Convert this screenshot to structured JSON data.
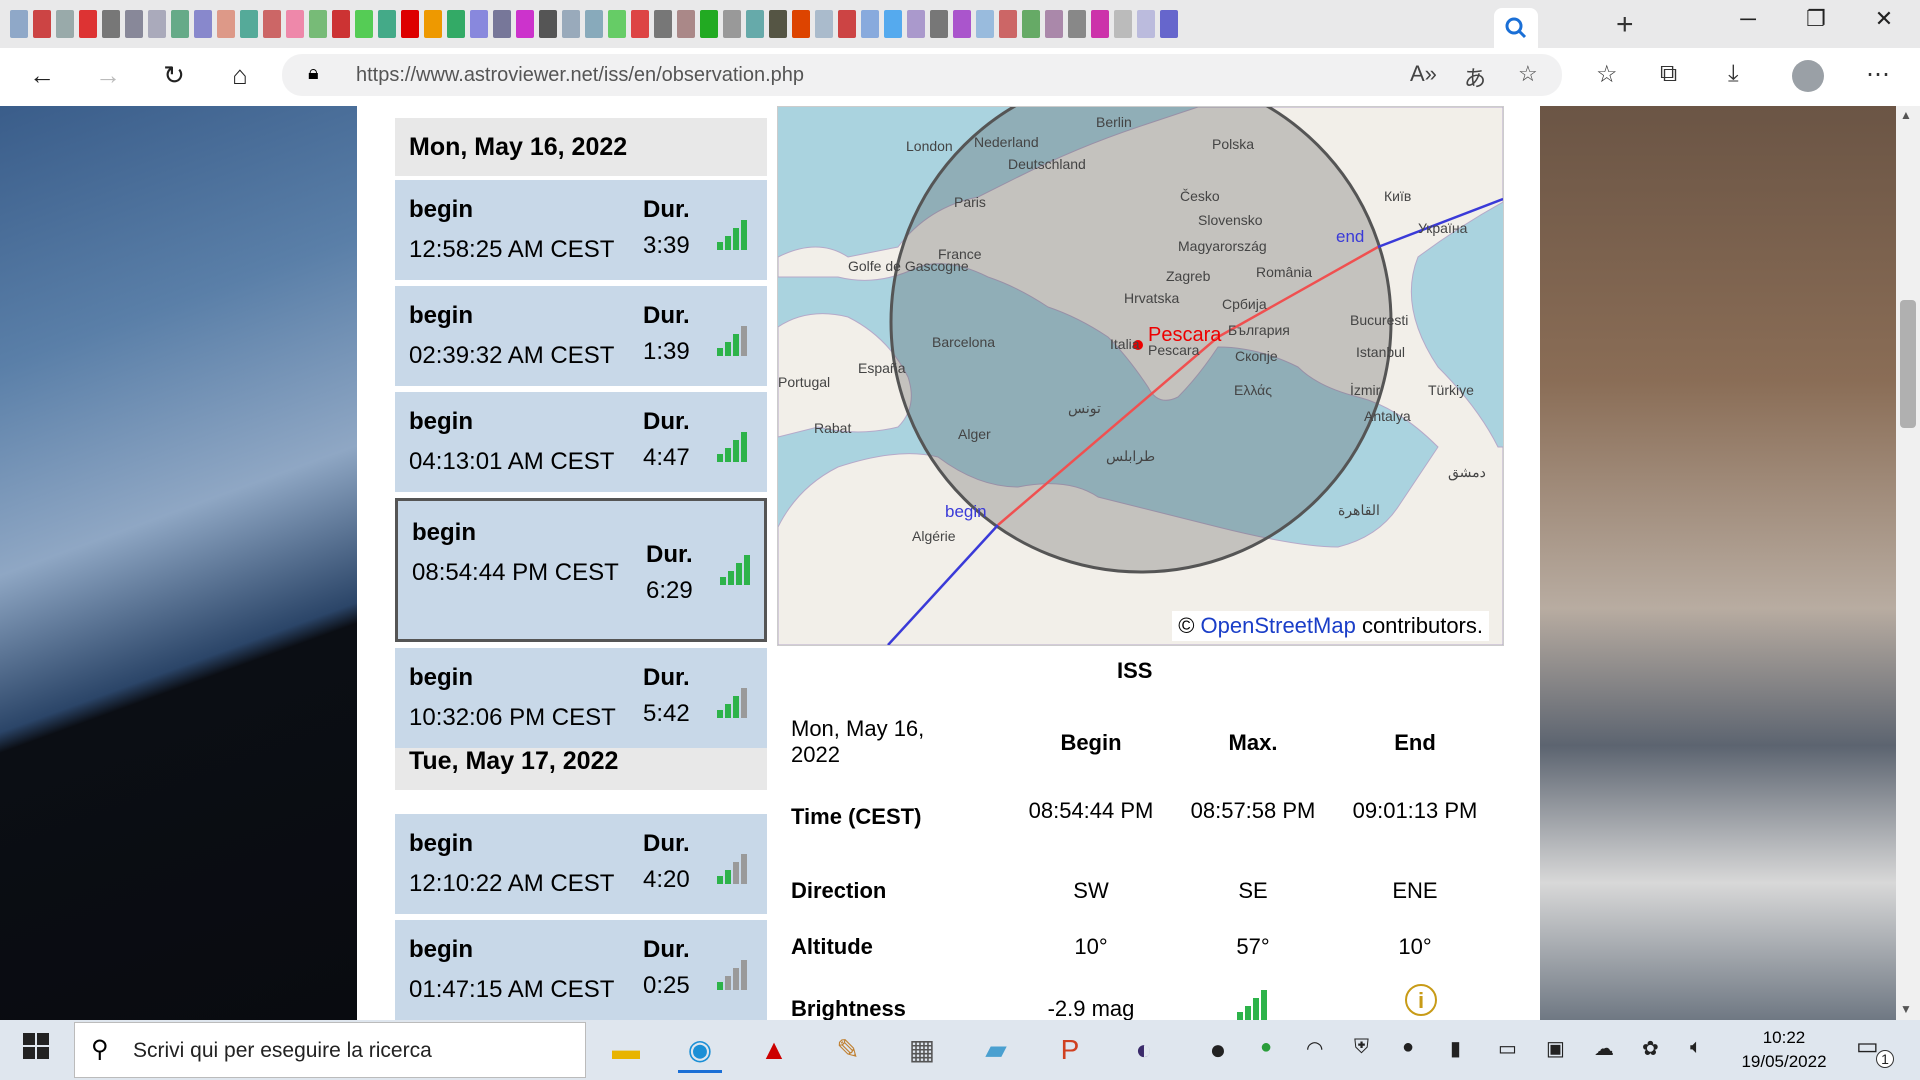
{
  "browser": {
    "url": "https://www.astroviewer.net/iss/en/observation.php",
    "new_tab_symbol": "+",
    "win_min": "─",
    "win_max": "❐",
    "win_close": "✕"
  },
  "passes": {
    "days": [
      {
        "label": "Mon, May 16, 2022"
      },
      {
        "label": "Tue, May 17, 2022"
      }
    ],
    "items": [
      {
        "begin_label": "begin",
        "time": "12:58:25 AM CEST",
        "dur_label": "Dur.",
        "duration": "3:39",
        "signal": 4,
        "selected": false
      },
      {
        "begin_label": "begin",
        "time": "02:39:32 AM CEST",
        "dur_label": "Dur.",
        "duration": "1:39",
        "signal": 3,
        "selected": false
      },
      {
        "begin_label": "begin",
        "time": "04:13:01 AM CEST",
        "dur_label": "Dur.",
        "duration": "4:47",
        "signal": 4,
        "selected": false
      },
      {
        "begin_label": "begin",
        "time": "08:54:44 PM CEST",
        "dur_label": "Dur.",
        "duration": "6:29",
        "signal": 4,
        "selected": true
      },
      {
        "begin_label": "begin",
        "time": "10:32:06 PM CEST",
        "dur_label": "Dur.",
        "duration": "5:42",
        "signal": 3,
        "selected": false
      },
      {
        "begin_label": "begin",
        "time": "12:10:22 AM CEST",
        "dur_label": "Dur.",
        "duration": "4:20",
        "signal": 2,
        "selected": false
      },
      {
        "begin_label": "begin",
        "time": "01:47:15 AM CEST",
        "dur_label": "Dur.",
        "duration": "0:25",
        "signal": 1,
        "selected": false
      }
    ]
  },
  "map": {
    "cities": [
      "London",
      "Nederland",
      "Berlin",
      "Polska",
      "Deutschland",
      "Paris",
      "Česko",
      "Київ",
      "Slovensko",
      "Україна",
      "France",
      "Magyarország",
      "Golfe de Gascogne",
      "Zagreb",
      "România",
      "Hrvatska",
      "Србија",
      "Bucuresti",
      "Barcelona",
      "Pescara",
      "България",
      "Italia",
      "Istanbul",
      "Скопје",
      "España",
      "Portugal",
      "Ελλάς",
      "İzmir",
      "Türkiye",
      "Antalya",
      "Rabat",
      "Alger",
      "تونس",
      "طرابلس",
      "Algérie",
      "القاهرة",
      "دمشق"
    ],
    "marker_label": "Pescara",
    "begin_label": "begin",
    "end_label": "end",
    "attribution_prefix": "© ",
    "attribution_link": "OpenStreetMap",
    "attribution_suffix": " contributors."
  },
  "details": {
    "satellite": "ISS",
    "date": "Mon, May 16, 2022",
    "columns": [
      "Begin",
      "Max.",
      "End"
    ],
    "rows": [
      {
        "label": "Time (CEST)",
        "values": [
          "08:54:44 PM",
          "08:57:58 PM",
          "09:01:13 PM"
        ]
      },
      {
        "label": "Direction",
        "values": [
          "SW",
          "SE",
          "ENE"
        ]
      },
      {
        "label": "Altitude",
        "values": [
          "10°",
          "57°",
          "10°"
        ]
      },
      {
        "label": "Brightness",
        "values": [
          "-2.9 mag",
          "",
          ""
        ]
      }
    ],
    "info_symbol": "i"
  },
  "taskbar": {
    "search_placeholder": "Scrivi qui per eseguire la ricerca",
    "time": "10:22",
    "date": "19/05/2022",
    "notification_count": "1"
  }
}
